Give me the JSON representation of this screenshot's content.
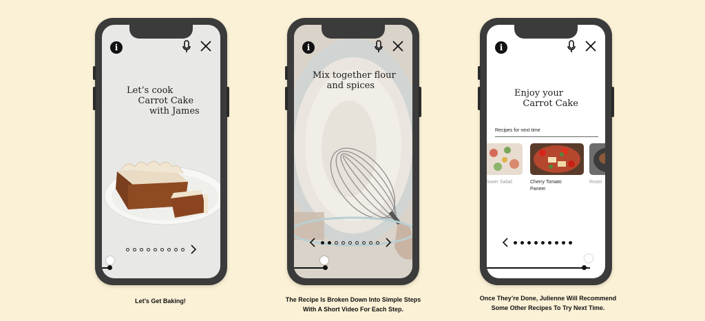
{
  "screens": [
    {
      "headline": "Let’s cook\n    Carrot Cake\n        with James",
      "caption": "Let’s Get Baking!"
    },
    {
      "headline": "Mix together flour\n     and spices",
      "caption": "The Recipe Is Broken Down Into Simple Steps\nWith A Short Video For Each Step."
    },
    {
      "headline": "Enjoy your\n   Carrot Cake",
      "caption": "Once They’re Done, Julienne Will Recommend\nSome Other Recipes To Try Next Time.",
      "recommend_label": "Recipes for next time",
      "recipes": [
        {
          "name": "Flower Salad"
        },
        {
          "name": "Cherry Tomato\nPaneer"
        },
        {
          "name": "Roast"
        }
      ]
    }
  ],
  "icons": {
    "info": "info-icon",
    "mic": "microphone-icon",
    "close": "close-icon",
    "prev": "chevron-left-icon",
    "next": "chevron-right-icon"
  },
  "colors": {
    "background": "#fbf1d6",
    "phone": "#3b3b3b"
  },
  "progress": {
    "screen1": 0.0,
    "screen2": 0.12,
    "screen3": 1.0
  }
}
